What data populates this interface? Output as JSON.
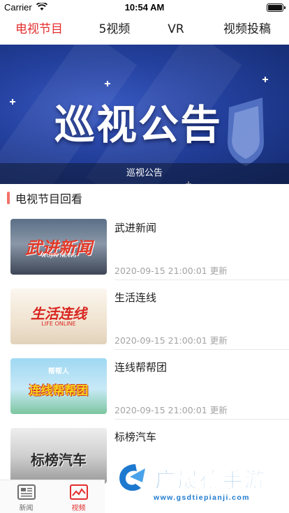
{
  "status_bar": {
    "carrier": "Carrier",
    "time": "10:54 AM"
  },
  "tabs": [
    {
      "label": "电视节目",
      "active": true
    },
    {
      "label": "5视频",
      "active": false
    },
    {
      "label": "VR",
      "active": false
    },
    {
      "label": "视频投稿",
      "active": false
    }
  ],
  "banner": {
    "title": "巡视公告",
    "caption": "巡视公告"
  },
  "section": {
    "title": "电视节目回看"
  },
  "programs": [
    {
      "title": "武进新闻",
      "updated": "2020-09-15 21:00:01 更新",
      "thumb_text": "武进新闻",
      "thumb_subtext": "WUJIN NEWS"
    },
    {
      "title": "生活连线",
      "updated": "2020-09-15 21:00:01 更新",
      "thumb_text": "生活连线",
      "thumb_subtext": "LIFE ONLINE"
    },
    {
      "title": "连线帮帮团",
      "updated": "2020-09-15 21:00:01 更新",
      "thumb_text": "连线帮帮团",
      "thumb_subtext": "帮帮人"
    },
    {
      "title": "标榜汽车",
      "updated": "",
      "thumb_text": "标榜汽车",
      "thumb_subtext": ""
    }
  ],
  "bottom_nav": [
    {
      "label": "新闻",
      "icon": "news-icon",
      "active": false
    },
    {
      "label": "视频",
      "icon": "video-icon",
      "active": true
    }
  ],
  "watermark": {
    "title": "广晟德手游",
    "url": "www.gsdtiepianji.com"
  },
  "colors": {
    "accent": "#e52d2d",
    "banner_blue": "#23409d",
    "watermark_blue": "#1d79cf"
  }
}
